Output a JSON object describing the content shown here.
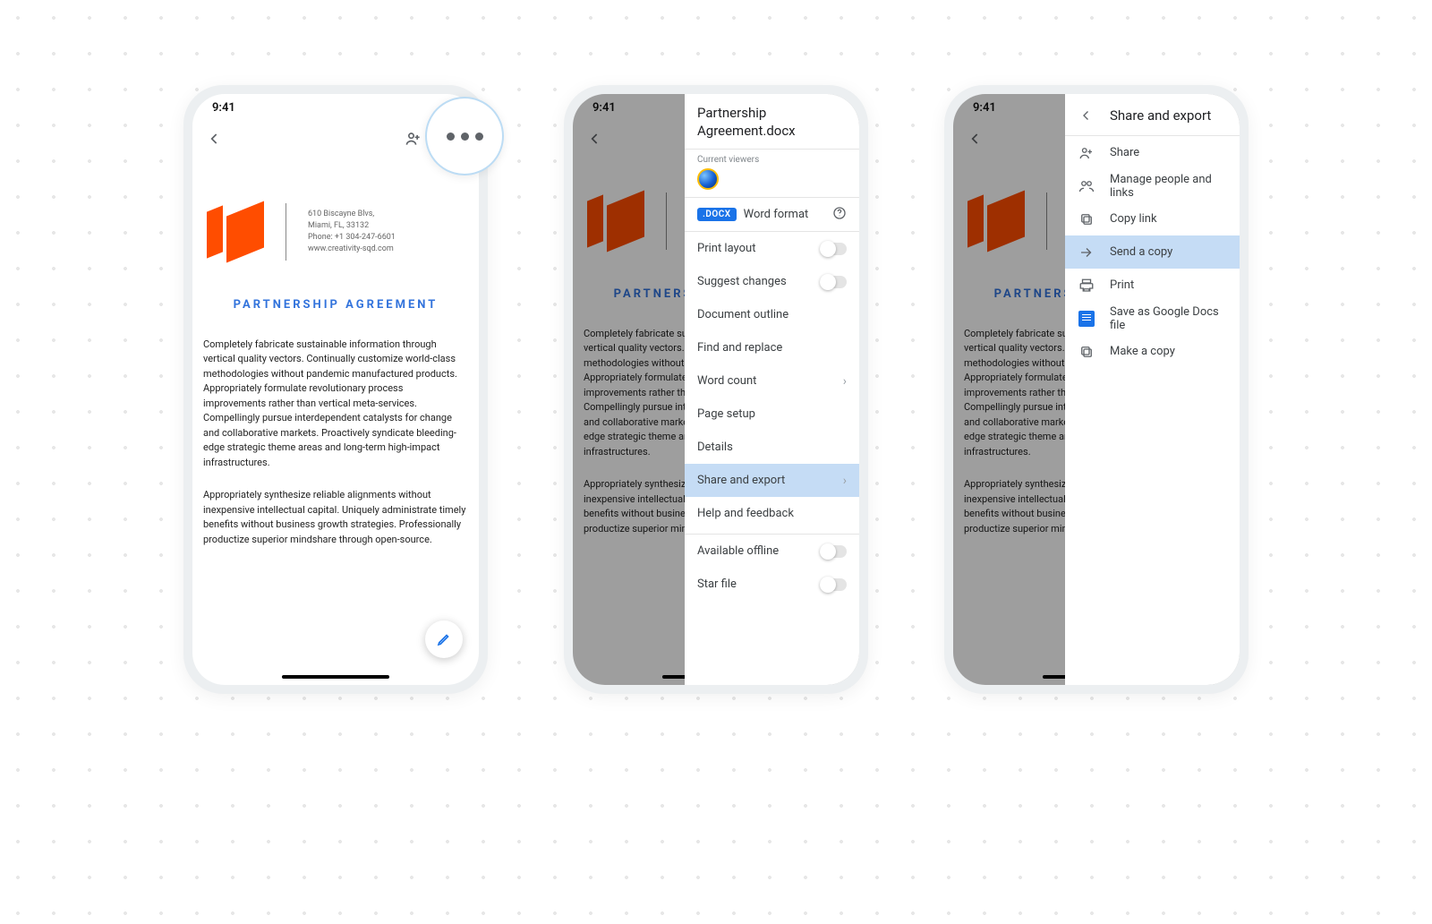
{
  "status": {
    "time": "9:41"
  },
  "doc": {
    "addr1": "610 Biscayne Blvs,",
    "addr2": "Miami, FL, 33132",
    "phone": "Phone: +1 304-247-6601",
    "web": "www.creativity-sqd.com",
    "title": "PARTNERSHIP AGREEMENT",
    "p1": "Completely fabricate sustainable information through vertical quality vectors. Continually customize world-class methodologies without pandemic manufactured products. Appropriately formulate revolutionary process improvements rather than vertical meta-services. Compellingly pursue interdependent catalysts for change and collaborative markets. Proactively syndicate bleeding-edge strategic theme areas and long-term high-impact infrastructures.",
    "p2": "Appropriately synthesize reliable alignments without inexpensive intellectual capital. Uniquely administrate timely benefits without business growth strategies. Professionally productize superior mindshare through open-source."
  },
  "panel1": {
    "title": "Partnership Agreement.docx",
    "current_viewers": "Current viewers",
    "docx_badge": ".DOCX",
    "word_format": "Word format",
    "items": {
      "print_layout": "Print layout",
      "suggest": "Suggest changes",
      "outline": "Document outline",
      "find": "Find and replace",
      "word_count": "Word count",
      "page_setup": "Page setup",
      "details": "Details",
      "share_export": "Share and export",
      "help": "Help and feedback",
      "offline": "Available offline",
      "star": "Star file"
    }
  },
  "panel2": {
    "title": "Share and export",
    "items": {
      "share": "Share",
      "manage": "Manage people and links",
      "copy_link": "Copy link",
      "send_copy": "Send a copy",
      "print": "Print",
      "save_gdocs": "Save as Google Docs file",
      "make_copy": "Make a copy"
    }
  }
}
